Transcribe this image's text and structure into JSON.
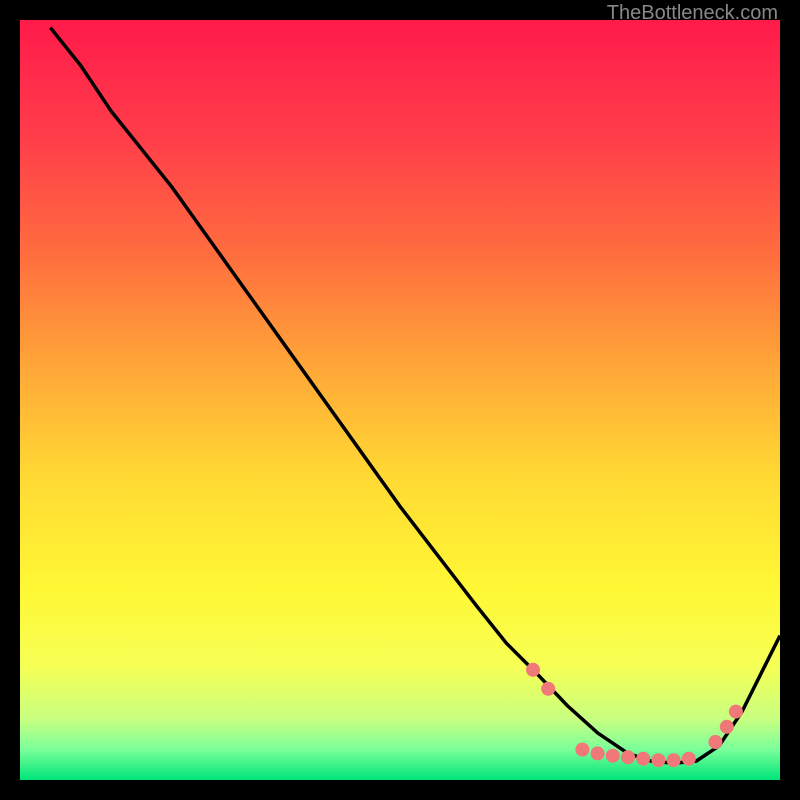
{
  "watermark": "TheBottleneck.com",
  "chart_data": {
    "type": "line",
    "title": "",
    "xlabel": "",
    "ylabel": "",
    "xlim": [
      0,
      100
    ],
    "ylim": [
      0,
      100
    ],
    "background_gradient": {
      "stops": [
        {
          "offset": 0.0,
          "color": "#ff1a4a"
        },
        {
          "offset": 0.15,
          "color": "#ff3c4a"
        },
        {
          "offset": 0.3,
          "color": "#ff6a3f"
        },
        {
          "offset": 0.45,
          "color": "#ffa438"
        },
        {
          "offset": 0.6,
          "color": "#ffd933"
        },
        {
          "offset": 0.75,
          "color": "#fff835"
        },
        {
          "offset": 0.85,
          "color": "#f6ff55"
        },
        {
          "offset": 0.92,
          "color": "#c8ff80"
        },
        {
          "offset": 0.96,
          "color": "#7aff9a"
        },
        {
          "offset": 1.0,
          "color": "#00e57a"
        }
      ]
    },
    "series": [
      {
        "name": "bottleneck-curve",
        "color": "#000000",
        "x": [
          4,
          8,
          12,
          16,
          20,
          25,
          30,
          35,
          40,
          45,
          50,
          55,
          60,
          64,
          68,
          72,
          76,
          80,
          83,
          86,
          89,
          92,
          95,
          100
        ],
        "y": [
          99,
          94,
          88,
          83,
          78,
          71,
          64,
          57,
          50,
          43,
          36,
          29.5,
          23,
          18,
          14,
          9.8,
          6.2,
          3.5,
          2.5,
          2.2,
          2.5,
          4.5,
          9,
          19
        ]
      }
    ],
    "markers": {
      "name": "highlight-points",
      "color": "#f07878",
      "radius": 7,
      "points": [
        {
          "x": 67.5,
          "y": 14.5
        },
        {
          "x": 69.5,
          "y": 12
        },
        {
          "x": 74,
          "y": 4.0
        },
        {
          "x": 76,
          "y": 3.5
        },
        {
          "x": 78,
          "y": 3.2
        },
        {
          "x": 80,
          "y": 3.0
        },
        {
          "x": 82,
          "y": 2.8
        },
        {
          "x": 84,
          "y": 2.6
        },
        {
          "x": 86,
          "y": 2.6
        },
        {
          "x": 88,
          "y": 2.8
        },
        {
          "x": 91.5,
          "y": 5.0
        },
        {
          "x": 93,
          "y": 7.0
        },
        {
          "x": 94.2,
          "y": 9.0
        }
      ]
    }
  }
}
